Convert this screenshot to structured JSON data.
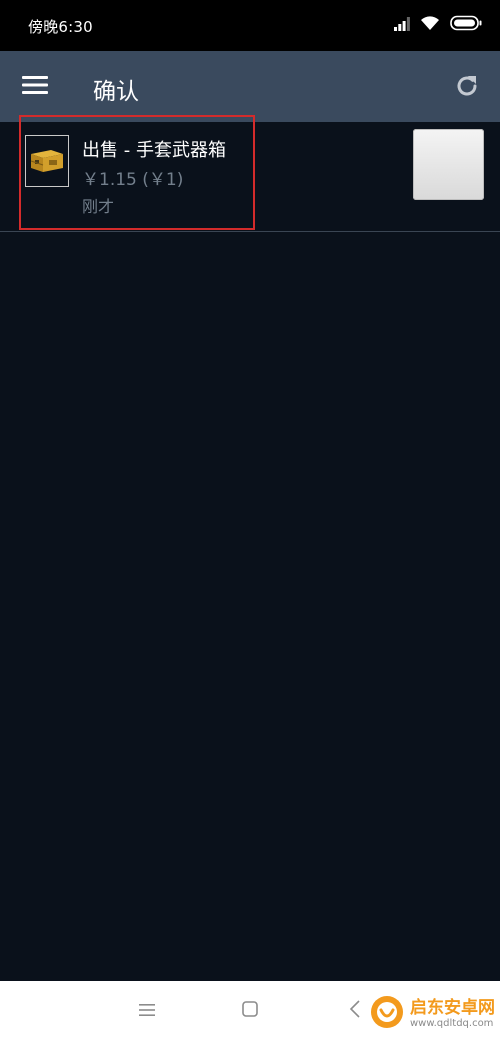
{
  "status_bar": {
    "time": "傍晚6:30",
    "icons": [
      "signal-icon",
      "wifi-icon",
      "battery-icon"
    ]
  },
  "header": {
    "title": "确认",
    "menu_icon": "hamburger-menu-icon",
    "refresh_icon": "refresh-icon",
    "background": "#3a4a5e"
  },
  "confirmations": [
    {
      "title": "出售 - 手套武器箱",
      "price": "￥1.15 (￥1)",
      "time": "刚才",
      "icon": "weapon-case-icon"
    }
  ],
  "nav_bar": {
    "icons": [
      "menu-nav-icon",
      "home-nav-icon",
      "back-nav-icon"
    ]
  },
  "watermark": {
    "name": "启东安卓网",
    "url": "www.qdltdq.com"
  },
  "colors": {
    "background": "#0a111b",
    "muted_text": "#737f8c",
    "highlight": "#d42b2b",
    "watermark": "#f39a1d"
  }
}
